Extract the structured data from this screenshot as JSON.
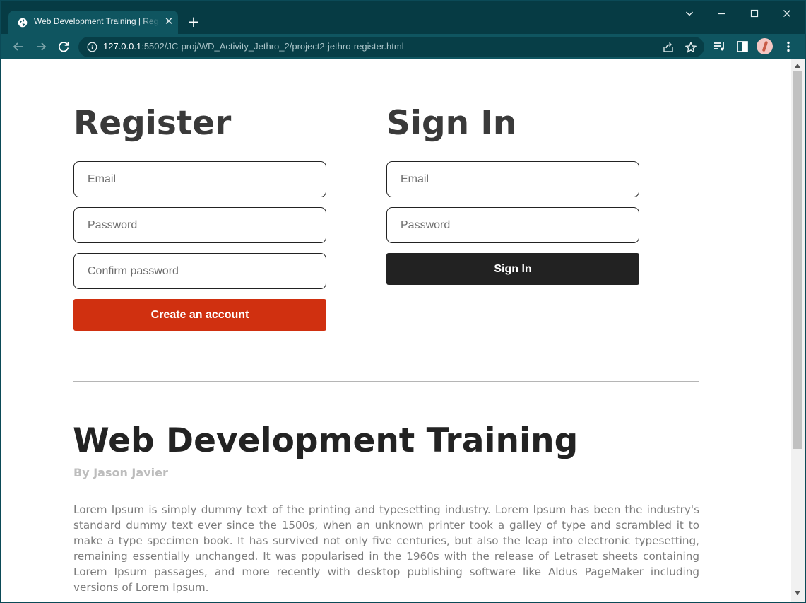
{
  "browser": {
    "tab_title": "Web Development Training | Register",
    "new_tab_symbol": "+",
    "url_host": "127.0.0.1",
    "url_path": ":5502/JC-proj/WD_Activity_Jethro_2/project2-jethro-register.html",
    "icons": [
      "globe-icon",
      "close-icon",
      "plus-icon",
      "chevron-down-icon",
      "minimize-icon",
      "maximize-icon",
      "close-window-icon",
      "back-arrow-icon",
      "forward-arrow-icon",
      "reload-icon",
      "info-icon",
      "share-icon",
      "star-icon",
      "reading-list-icon",
      "side-panel-icon",
      "avatar-icon",
      "kebab-menu-icon"
    ],
    "colors": {
      "frame": "#063b44",
      "toolbar": "#0f5560",
      "omnibox": "#073e47"
    }
  },
  "register": {
    "heading": "Register",
    "email_placeholder": "Email",
    "password_placeholder": "Password",
    "confirm_placeholder": "Confirm password",
    "submit_label": "Create an account"
  },
  "signin": {
    "heading": "Sign In",
    "email_placeholder": "Email",
    "password_placeholder": "Password",
    "submit_label": "Sign In"
  },
  "article": {
    "title": "Web Development Training",
    "byline": "By Jason Javier",
    "body": "Lorem Ipsum is simply dummy text of the printing and typesetting industry. Lorem Ipsum has been the industry's standard dummy text ever since the 1500s, when an unknown printer took a galley of type and scrambled it to make a type specimen book. It has survived not only five centuries, but also the leap into electronic typesetting, remaining essentially unchanged. It was popularised in the 1960s with the release of Letraset sheets containing Lorem Ipsum passages, and more recently with desktop publishing software like Aldus PageMaker including versions of Lorem Ipsum."
  },
  "colors": {
    "create_button": "#d03010",
    "signin_button": "#222222",
    "heading_text": "#3a3a3a"
  }
}
